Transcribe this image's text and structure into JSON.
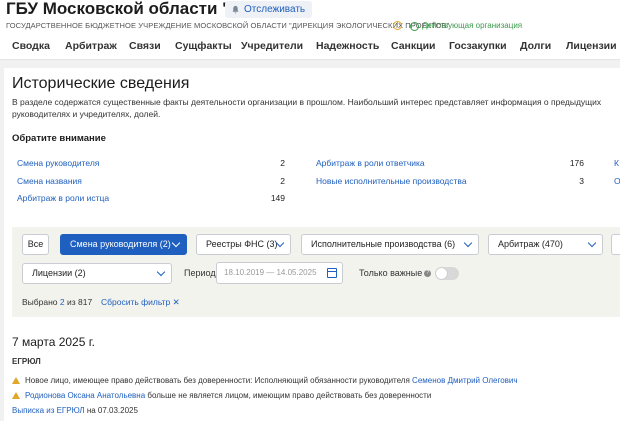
{
  "header": {
    "company_name": "ГБУ Московской области \"ДЭП\"",
    "track_label": "Отслеживать",
    "full_name": "ГОСУДАРСТВЕННОЕ БЮДЖЕТНОЕ УЧРЕЖДЕНИЕ МОСКОВСКОЙ ОБЛАСТИ \"ДИРЕКЦИЯ ЭКОЛОГИЧЕСКИХ ПРОЕКТОВ\"",
    "status": "Действующая организация"
  },
  "nav": {
    "items": [
      {
        "label": "Сводка"
      },
      {
        "label": "Арбитраж"
      },
      {
        "label": "Связи"
      },
      {
        "label": "Сущфакты"
      },
      {
        "label": "Учредители"
      },
      {
        "label": "Надежность"
      },
      {
        "label": "Санкции"
      },
      {
        "label": "Госзакупки"
      },
      {
        "label": "Долги"
      },
      {
        "label": "Лицензии"
      }
    ]
  },
  "section": {
    "title": "Исторические сведения",
    "description": "В разделе содержатся существенные факты деятельности организации в прошлом. Наибольший интерес представляет информация о предыдущих руководителях и учредителях, долей."
  },
  "attention": {
    "title": "Обратите внимание",
    "stats": [
      {
        "label": "Смена руководителя",
        "count": "2"
      },
      {
        "label": "Смена названия",
        "count": "2"
      },
      {
        "label": "Арбитраж в роли истца",
        "count": "149"
      },
      {
        "label": "Арбитраж в роли ответчика",
        "count": "176"
      },
      {
        "label": "Новые исполнительные производства",
        "count": "3"
      },
      {
        "label": "К",
        "count": ""
      },
      {
        "label": "О",
        "count": ""
      }
    ]
  },
  "filters": {
    "all_label": "Все",
    "buttons": [
      {
        "label": "Смена руководителя (2)",
        "active": true
      },
      {
        "label": "Реестры ФНС (3)",
        "active": false
      },
      {
        "label": "Исполнительные производства (6)",
        "active": false
      },
      {
        "label": "Арбитраж (470)",
        "active": false
      },
      {
        "label": "Лицензии (2)",
        "active": false
      }
    ],
    "period_label": "Период",
    "period_value": "18.10.2019 — 14.05.2025",
    "important_label": "Только важные",
    "selected_prefix": "Выбрано",
    "selected_count": "2",
    "selected_suffix": "из 817",
    "reset_label": "Сбросить фильтр ✕"
  },
  "events": {
    "date": "7 марта 2025 г.",
    "source": "ЕГРЮЛ",
    "items": [
      {
        "text": "Новое лицо, имеющее право действовать без доверенности: Исполняющий обязанности руководителя",
        "link": "Семенов Дмитрий Олегович",
        "after": ""
      },
      {
        "text": "",
        "link": "Родионова Оксана Анатольевна",
        "after": "больше не является лицом, имеющим право действовать без доверенности"
      }
    ],
    "extract_link": "Выписка из ЕГРЮЛ",
    "extract_suffix": "на 07.03.2025"
  },
  "colors": {
    "accent": "#1f5fbf",
    "warning": "#e0a72b",
    "success": "#3b9b4d",
    "panel": "#f3f3ee"
  }
}
